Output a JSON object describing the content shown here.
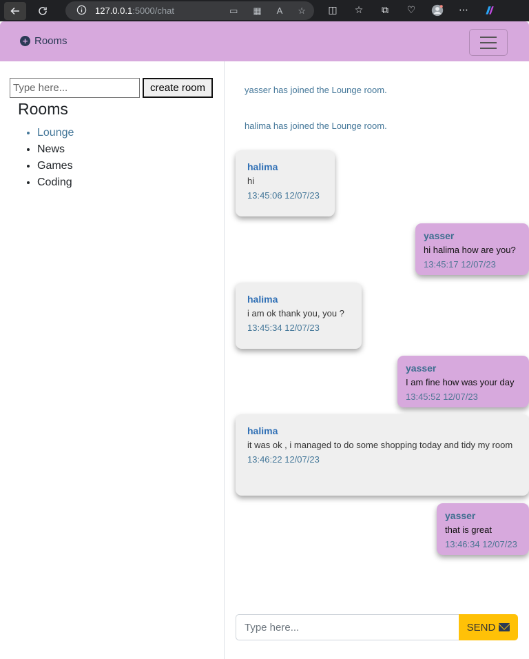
{
  "browser": {
    "url_host": "127.0.0.1",
    "url_path": ":5000/chat"
  },
  "navbar": {
    "brand_label": "Rooms"
  },
  "sidebar": {
    "room_input_placeholder": "Type here...",
    "create_button_label": "create room",
    "title": "Rooms",
    "rooms": [
      {
        "label": "Lounge",
        "active": true
      },
      {
        "label": "News",
        "active": false
      },
      {
        "label": "Games",
        "active": false
      },
      {
        "label": "Coding",
        "active": false
      }
    ]
  },
  "chat": {
    "system_messages": [
      "yasser has joined the Lounge room.",
      "halima has joined the Lounge room."
    ],
    "messages": [
      {
        "user": "halima",
        "text": "hi",
        "time": "13:45:06 12/07/23",
        "side": "left"
      },
      {
        "user": "yasser",
        "text": "hi halima how are you?",
        "time": "13:45:17 12/07/23",
        "side": "right"
      },
      {
        "user": "halima",
        "text": "i am ok thank you, you ?",
        "time": "13:45:34 12/07/23",
        "side": "left"
      },
      {
        "user": "yasser",
        "text": "I am fine how was your day",
        "time": "13:45:52 12/07/23",
        "side": "right"
      },
      {
        "user": "halima",
        "text": "it was ok , i managed to do some shopping today and tidy my room",
        "time": "13:46:22 12/07/23",
        "side": "left"
      },
      {
        "user": "yasser",
        "text": "that is great",
        "time": "13:46:34 12/07/23",
        "side": "right"
      }
    ],
    "input_placeholder": "Type here...",
    "send_label": "SEND"
  },
  "colors": {
    "navbar_bg": "#d7a9dd",
    "left_bubble_bg": "#efefef",
    "right_bubble_bg": "#d7a9dd",
    "send_button_bg": "#ffc107",
    "accent_link": "#447799"
  }
}
